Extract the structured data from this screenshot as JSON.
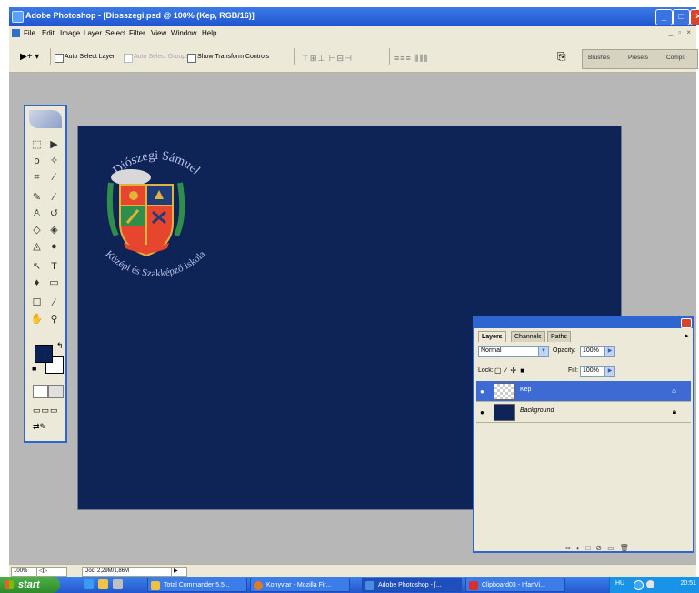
{
  "window": {
    "title": "Adobe Photoshop - [Diosszegi.psd @ 100% (Kep, RGB/16)]",
    "accent_color": "#2d65d1"
  },
  "menu": [
    "File",
    "Edit",
    "Image",
    "Layer",
    "Select",
    "Filter",
    "View",
    "Window",
    "Help"
  ],
  "options_bar": {
    "auto_select_layer": "Auto Select Layer",
    "auto_select_groups": "Auto Select Groups",
    "show_transform_controls": "Show Transform Controls",
    "palette_wells": [
      "Brushes",
      "Presets",
      "Comps"
    ]
  },
  "canvas": {
    "background_color": "#0e2356",
    "logo": {
      "arc_text_top": "Diószegi Sámuel",
      "arc_text_bottom": "Középi és Szakképző Iskola",
      "colors": {
        "red": "#e8452f",
        "green": "#2f8f4a",
        "navy": "#1f3c7a",
        "gold": "#e0b33a"
      }
    }
  },
  "layers_palette": {
    "tabs": [
      "Layers",
      "Channels",
      "Paths"
    ],
    "blend_mode": "Normal",
    "opacity_label": "Opacity:",
    "opacity_value": "100%",
    "lock_label": "Lock:",
    "fill_label": "Fill:",
    "fill_value": "100%",
    "layers": [
      {
        "name": "Kep",
        "selected": true,
        "visible": true,
        "locked": false
      },
      {
        "name": "Background",
        "selected": false,
        "visible": true,
        "locked": true
      }
    ]
  },
  "status_bar": {
    "zoom": "100%",
    "doc_info": "Doc: 2,29M/1,86M"
  },
  "taskbar": {
    "start_label": "start",
    "tasks": [
      {
        "label": "Total Commander 5.5...",
        "active": false,
        "icon_color": "#f0c040"
      },
      {
        "label": "Konyvtar - Mozilla Fir...",
        "active": false,
        "icon_color": "#e07a2a"
      },
      {
        "label": "Adobe Photoshop - [...",
        "active": true,
        "icon_color": "#4a8de0"
      },
      {
        "label": "Clipboard03 - IrfanVi...",
        "active": false,
        "icon_color": "#d83030"
      }
    ],
    "language": "HU",
    "clock": "20:51"
  }
}
